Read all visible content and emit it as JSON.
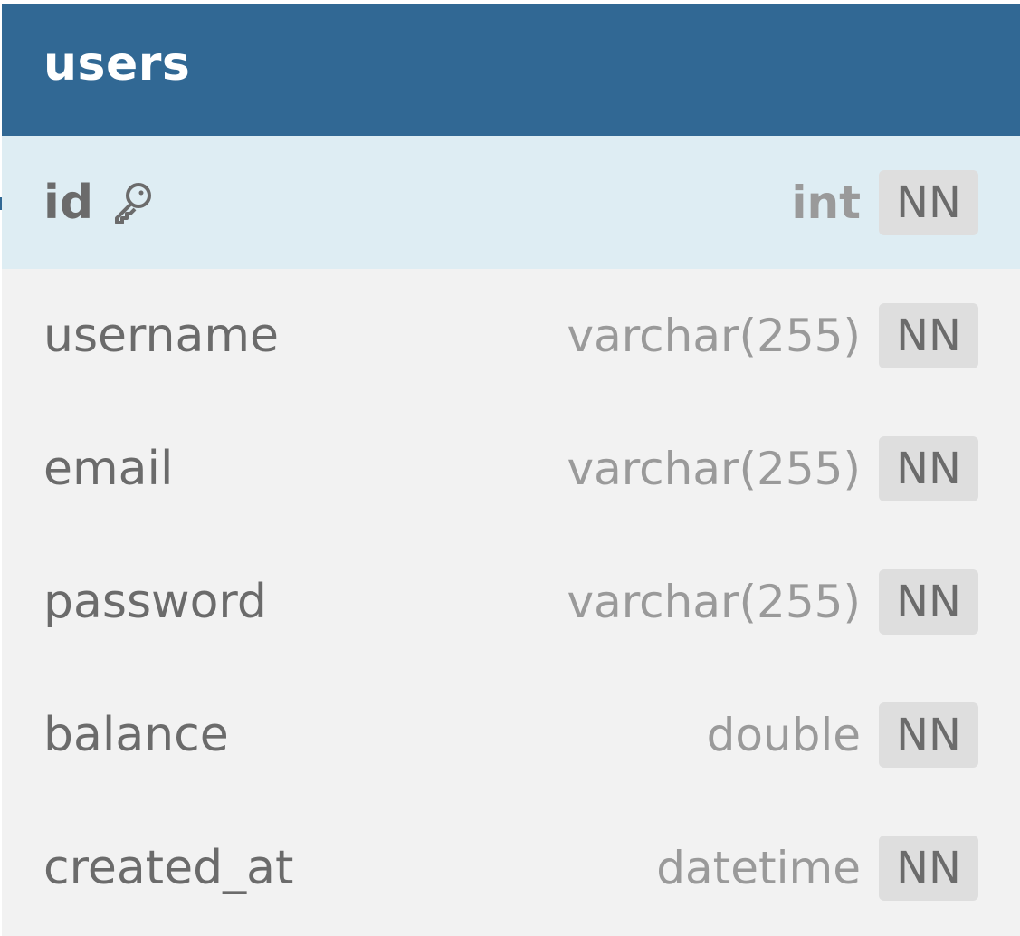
{
  "table": {
    "name": "users",
    "colors": {
      "header": "#316894",
      "pk_row": "#deedf3",
      "row": "#f2f2f2",
      "badge": "#dedede"
    },
    "fields": [
      {
        "name": "id",
        "type": "int",
        "constraint": "NN",
        "primary_key": true,
        "icon": "key-icon"
      },
      {
        "name": "username",
        "type": "varchar(255)",
        "constraint": "NN"
      },
      {
        "name": "email",
        "type": "varchar(255)",
        "constraint": "NN"
      },
      {
        "name": "password",
        "type": "varchar(255)",
        "constraint": "NN"
      },
      {
        "name": "balance",
        "type": "double",
        "constraint": "NN"
      },
      {
        "name": "created_at",
        "type": "datetime",
        "constraint": "NN"
      }
    ]
  }
}
